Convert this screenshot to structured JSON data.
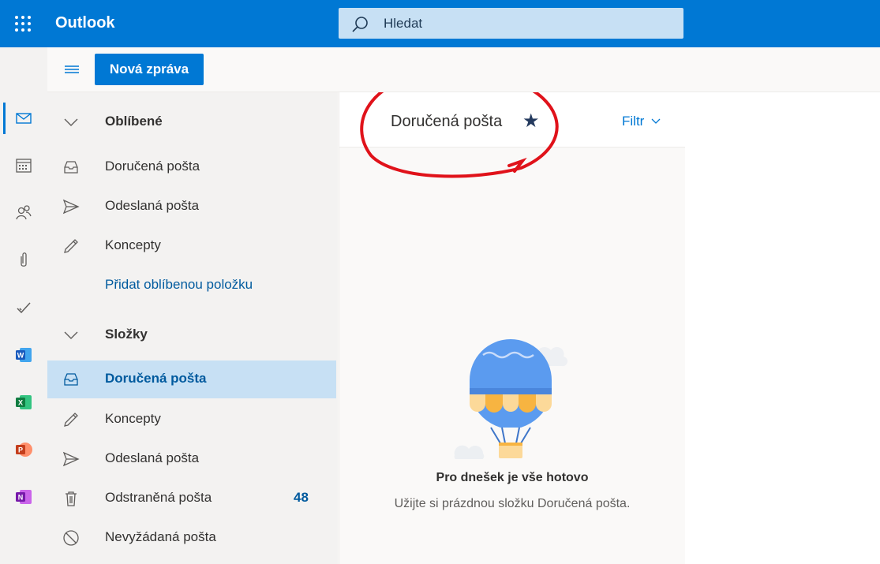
{
  "app": {
    "title": "Outlook"
  },
  "search": {
    "placeholder": "Hledat"
  },
  "toolbar": {
    "new_message_label": "Nová zpráva"
  },
  "rail": {
    "items": [
      {
        "icon": "mail-icon",
        "active": true
      },
      {
        "icon": "calendar-icon"
      },
      {
        "icon": "people-icon"
      },
      {
        "icon": "attachment-icon"
      },
      {
        "icon": "todo-icon"
      },
      {
        "icon": "word-icon",
        "letter": "W"
      },
      {
        "icon": "excel-icon",
        "letter": "X"
      },
      {
        "icon": "powerpoint-icon",
        "letter": "P"
      },
      {
        "icon": "onenote-icon",
        "letter": "N"
      }
    ]
  },
  "folders": {
    "favorites_header": "Oblíbené",
    "favorites": [
      {
        "label": "Doručená pošta",
        "icon": "inbox-icon"
      },
      {
        "label": "Odeslaná pošta",
        "icon": "send-icon"
      },
      {
        "label": "Koncepty",
        "icon": "pencil-icon"
      }
    ],
    "add_favorite": "Přidat oblíbenou položku",
    "folders_header": "Složky",
    "items": [
      {
        "label": "Doručená pošta",
        "icon": "inbox-icon",
        "selected": true
      },
      {
        "label": "Koncepty",
        "icon": "pencil-icon"
      },
      {
        "label": "Odeslaná pošta",
        "icon": "send-icon"
      },
      {
        "label": "Odstraněná pošta",
        "icon": "trash-icon",
        "count": "48"
      },
      {
        "label": "Nevyžádaná pošta",
        "icon": "block-icon"
      }
    ]
  },
  "message_list": {
    "title": "Doručená pošta",
    "filter_label": "Filtr",
    "empty_title": "Pro dnešek je vše hotovo",
    "empty_subtitle": "Užijte si prázdnou složku Doručená pošta."
  },
  "colors": {
    "brand": "#0078d4",
    "selected": "#c7e0f4",
    "annotation": "#e0121a"
  }
}
